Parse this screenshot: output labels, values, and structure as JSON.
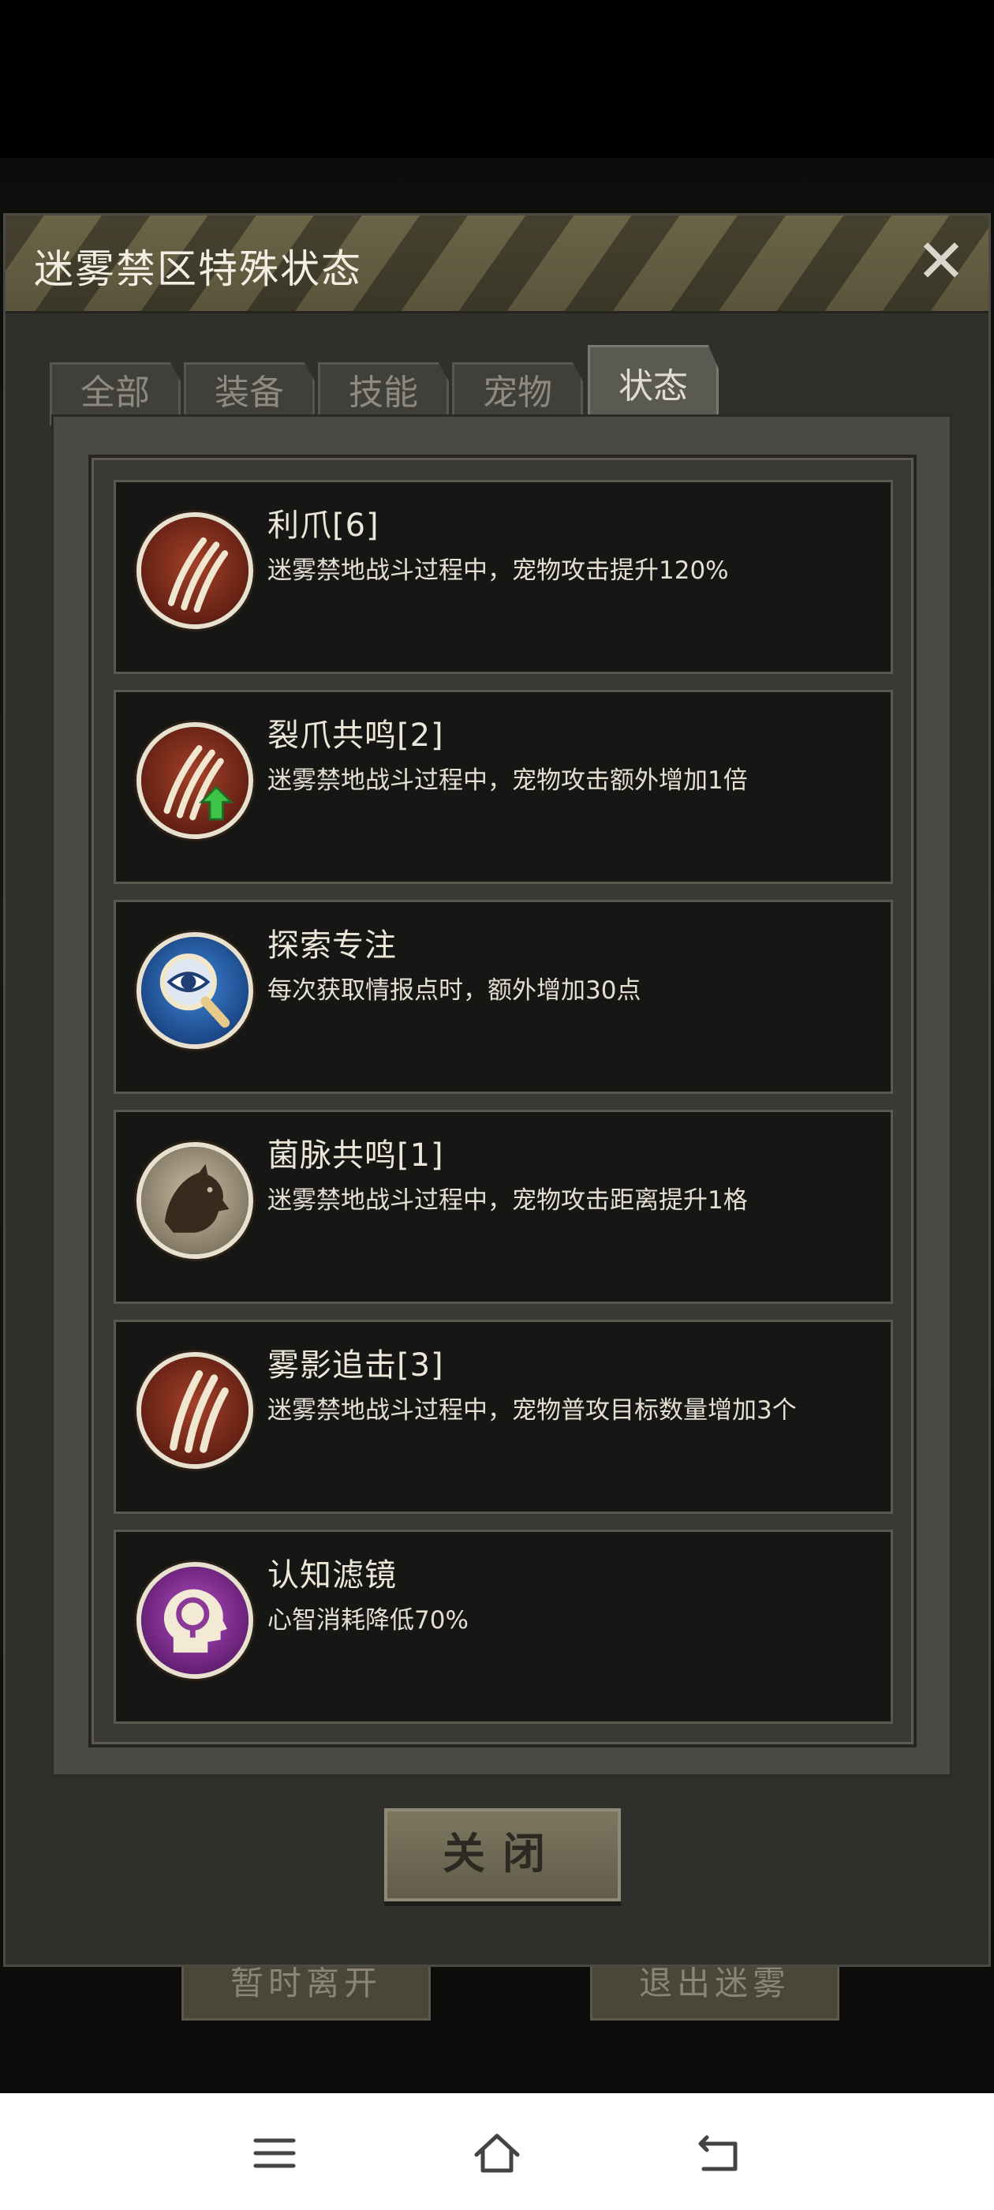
{
  "dialog": {
    "title": "迷雾禁区特殊状态",
    "close_icon": "close-icon"
  },
  "tabs": [
    {
      "label": "全部",
      "active": false
    },
    {
      "label": "装备",
      "active": false
    },
    {
      "label": "技能",
      "active": false
    },
    {
      "label": "宠物",
      "active": false
    },
    {
      "label": "状态",
      "active": true
    }
  ],
  "status_items": [
    {
      "name": "利爪[6]",
      "desc": "迷雾禁地战斗过程中，宠物攻击提升120%",
      "icon": "claw-icon"
    },
    {
      "name": "裂爪共鸣[2]",
      "desc": "迷雾禁地战斗过程中，宠物攻击额外增加1倍",
      "icon": "claw-upgrade-icon"
    },
    {
      "name": "探索专注",
      "desc": "每次获取情报点时，额外增加30点",
      "icon": "eye-magnifier-icon"
    },
    {
      "name": "菌脉共鸣[1]",
      "desc": "迷雾禁地战斗过程中，宠物攻击距离提升1格",
      "icon": "beast-silhouette-icon"
    },
    {
      "name": "雾影追击[3]",
      "desc": "迷雾禁地战斗过程中，宠物普攻目标数量增加3个",
      "icon": "slash-icon"
    },
    {
      "name": "认知滤镜",
      "desc": "心智消耗降低70%",
      "icon": "mind-head-icon"
    }
  ],
  "close_button": {
    "label": "关闭"
  },
  "background_buttons": {
    "left": "暂时离开",
    "right": "退出迷雾"
  },
  "navbar": {
    "menu_icon": "menu-icon",
    "home_icon": "home-icon",
    "back_icon": "back-icon"
  }
}
